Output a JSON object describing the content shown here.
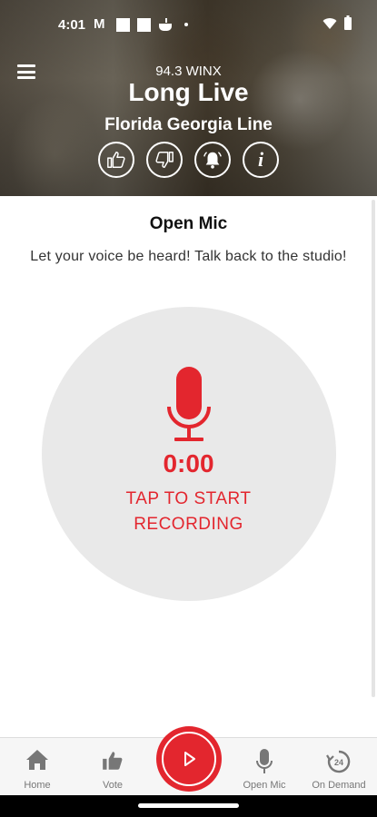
{
  "status_bar": {
    "time": "4:01",
    "mail_letter": "M"
  },
  "header": {
    "station": "94.3 WINX",
    "song": "Long Live",
    "artist": "Florida Georgia Line",
    "info_symbol": "i"
  },
  "open_mic": {
    "title": "Open Mic",
    "description": "Let your voice be heard! Talk back to the studio!",
    "timer": "0:00",
    "tap_prompt": "TAP TO START RECORDING"
  },
  "nav": {
    "items": [
      {
        "label": "Home",
        "icon": "home-icon"
      },
      {
        "label": "Vote",
        "icon": "thumbs-up-icon"
      },
      {
        "label": "Open Mic",
        "icon": "microphone-icon"
      },
      {
        "label": "On Demand",
        "icon": "history-24-icon"
      }
    ],
    "on_demand_badge": "24"
  },
  "colors": {
    "accent": "#e3262e",
    "record_bg": "#e9e9e9"
  }
}
